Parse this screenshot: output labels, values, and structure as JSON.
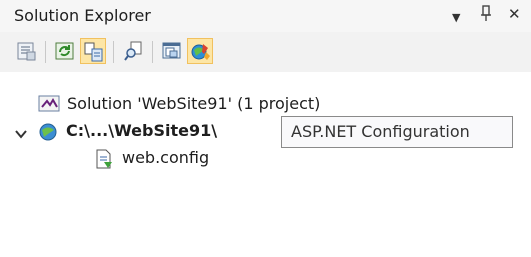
{
  "window": {
    "title": "Solution Explorer",
    "controls": {
      "dropdown": "▼",
      "pin": "ᵖ",
      "close": "✕"
    }
  },
  "toolbar": {
    "buttons": [
      {
        "name": "properties",
        "icon": "properties-icon"
      },
      {
        "name": "refresh",
        "icon": "refresh-icon"
      },
      {
        "name": "nest-related-files",
        "icon": "nest-files-icon",
        "pressed": true
      },
      {
        "name": "view-class-diagram",
        "icon": "search-find-icon"
      },
      {
        "name": "copy-website",
        "icon": "copy-website-icon"
      },
      {
        "name": "aspnet-configuration",
        "icon": "aspnet-configuration-icon",
        "pressed": true
      }
    ]
  },
  "tree": {
    "solution": {
      "label": "Solution 'WebSite91' (1 project)"
    },
    "project": {
      "label": "C:\\...\\WebSite91\\",
      "expanded": true
    },
    "file": {
      "label": "web.config"
    }
  },
  "tooltip": {
    "text": "ASP.NET Configuration"
  }
}
